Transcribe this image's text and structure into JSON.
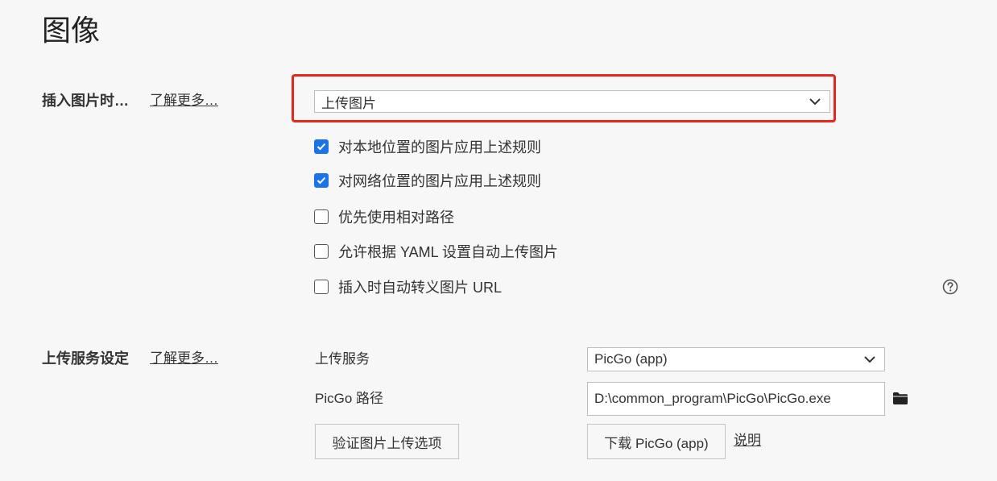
{
  "page": {
    "title": "图像"
  },
  "insert_image": {
    "label": "插入图片时…",
    "learn_more": "了解更多…",
    "select_value": "上传图片",
    "options": [
      {
        "label": "对本地位置的图片应用上述规则",
        "checked": true
      },
      {
        "label": "对网络位置的图片应用上述规则",
        "checked": true
      },
      {
        "label": "优先使用相对路径",
        "checked": false
      },
      {
        "label": "允许根据 YAML 设置自动上传图片",
        "checked": false
      },
      {
        "label": "插入时自动转义图片 URL",
        "checked": false
      }
    ],
    "help_icon": "question-circle-icon"
  },
  "upload_service": {
    "label": "上传服务设定",
    "learn_more": "了解更多…",
    "service_label": "上传服务",
    "service_value": "PicGo (app)",
    "path_label": "PicGo 路径",
    "path_value": "D:\\common_program\\PicGo\\PicGo.exe",
    "folder_icon": "folder-icon",
    "validate_button": "验证图片上传选项",
    "download_button": "下载 PicGo (app)",
    "explain_link": "说明"
  },
  "colors": {
    "highlight": "#e6271f",
    "checkbox_checked": "#1a73e8",
    "background": "#f7f7f7"
  }
}
